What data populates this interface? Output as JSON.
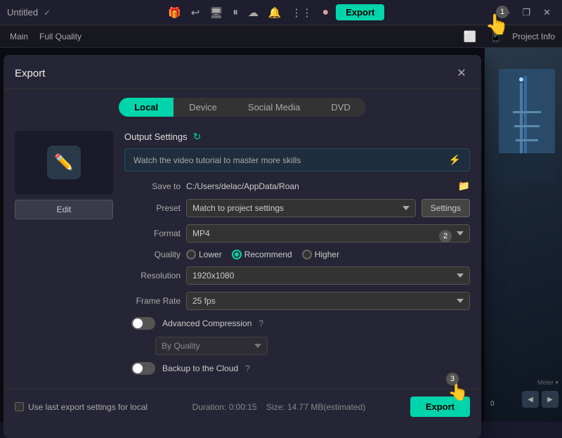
{
  "topbar": {
    "title": "Untitled",
    "export_label": "Export",
    "project_info_label": "Project Info"
  },
  "subbar": {
    "main_label": "Main",
    "full_quality_label": "Full Quality"
  },
  "dialog": {
    "title": "Export",
    "close_label": "✕",
    "tabs": [
      {
        "id": "local",
        "label": "Local",
        "active": true
      },
      {
        "id": "device",
        "label": "Device",
        "active": false
      },
      {
        "id": "social",
        "label": "Social Media",
        "active": false
      },
      {
        "id": "dvd",
        "label": "DVD",
        "active": false
      }
    ],
    "output_settings_label": "Output Settings",
    "tutorial_text": "Watch the video tutorial to master more skills",
    "edit_btn_label": "Edit",
    "form": {
      "save_to_label": "Save to",
      "save_path": "C:/Users/delac/AppData/Roan",
      "preset_label": "Preset",
      "preset_value": "Match to project settings",
      "settings_btn_label": "Settings",
      "format_label": "Format",
      "format_value": "MP4",
      "quality_label": "Quality",
      "quality_options": [
        {
          "id": "lower",
          "label": "Lower",
          "checked": false
        },
        {
          "id": "recommend",
          "label": "Recommend",
          "checked": true
        },
        {
          "id": "higher",
          "label": "Higher",
          "checked": false
        }
      ],
      "resolution_label": "Resolution",
      "resolution_value": "1920x1080",
      "frame_rate_label": "Frame Rate",
      "frame_rate_value": "25 fps",
      "advanced_compression_label": "Advanced Compression",
      "advanced_compression_on": false,
      "by_quality_value": "By Quality",
      "backup_cloud_label": "Backup to the Cloud",
      "backup_cloud_on": false
    },
    "footer": {
      "use_last_settings_label": "Use last export settings for local",
      "duration_label": "Duration: 0:00:15",
      "size_label": "Size: 14.77 MB(estimated)",
      "export_btn_label": "Export"
    }
  }
}
